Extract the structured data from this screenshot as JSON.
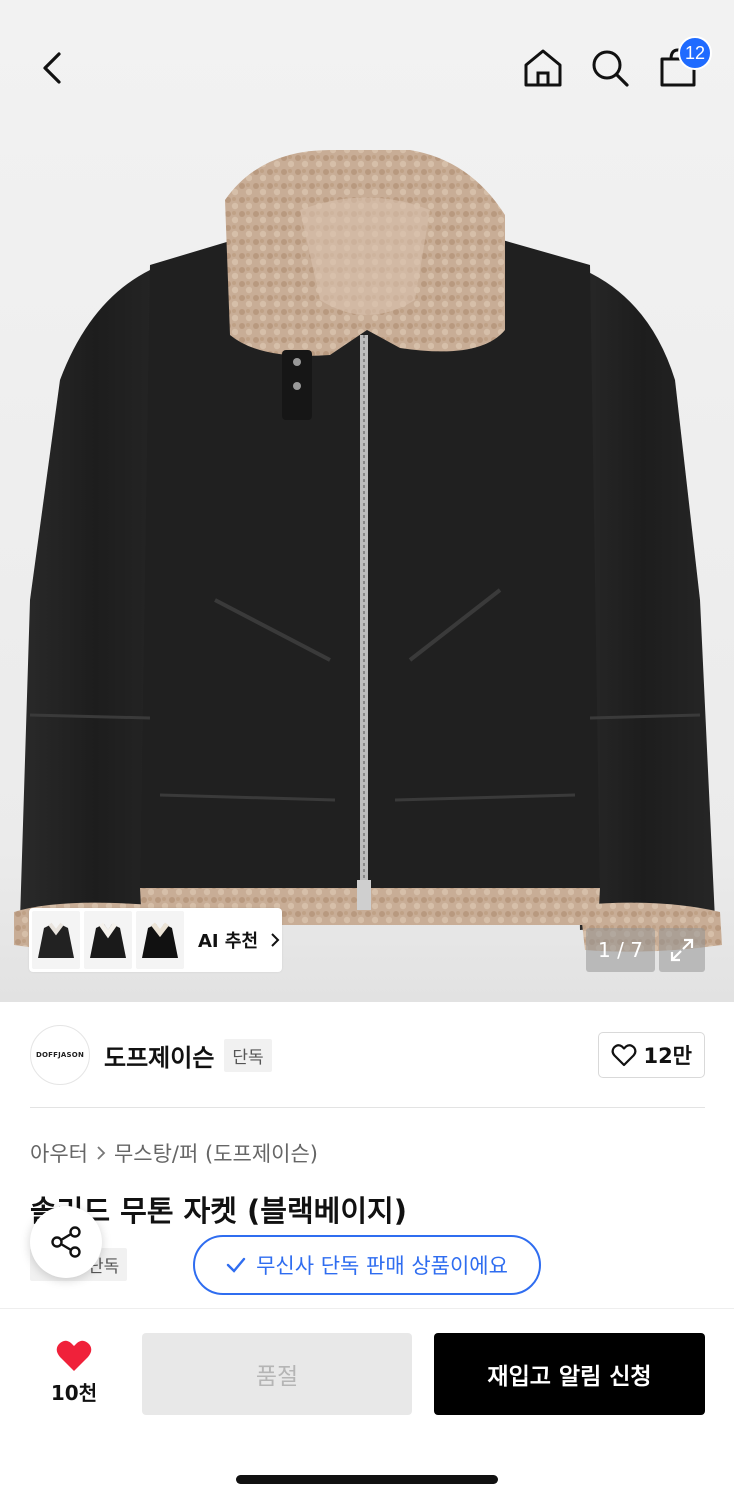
{
  "header": {
    "back_icon": "chevron-left-icon",
    "home_icon": "home-icon",
    "search_icon": "search-icon",
    "cart_icon": "shopping-bag-icon",
    "cart_count": "12",
    "badge_color": "#1f6bff"
  },
  "gallery": {
    "ai_label": "AI 추천",
    "counter": "1 / 7",
    "expand_icon": "expand-icon"
  },
  "brand": {
    "logo_text": "DOFFJASON",
    "name": "도프제이슨",
    "tag": "단독",
    "like_count": "12만",
    "like_icon": "heart-outline-icon"
  },
  "product": {
    "breadcrumb": [
      "아우터",
      "무스탕/퍼 (도프제이슨)"
    ],
    "title": "솔리드 무톤 자켓 (블랙베이지)",
    "tag": "단독",
    "exclusive_notice": "무신사 단독 판매 상품이에요",
    "accent_color": "#2f6df0"
  },
  "bottom": {
    "wish_count": "10천",
    "wish_color": "#f0213a",
    "soldout_label": "품절",
    "restock_label": "재입고 알림 신청"
  }
}
